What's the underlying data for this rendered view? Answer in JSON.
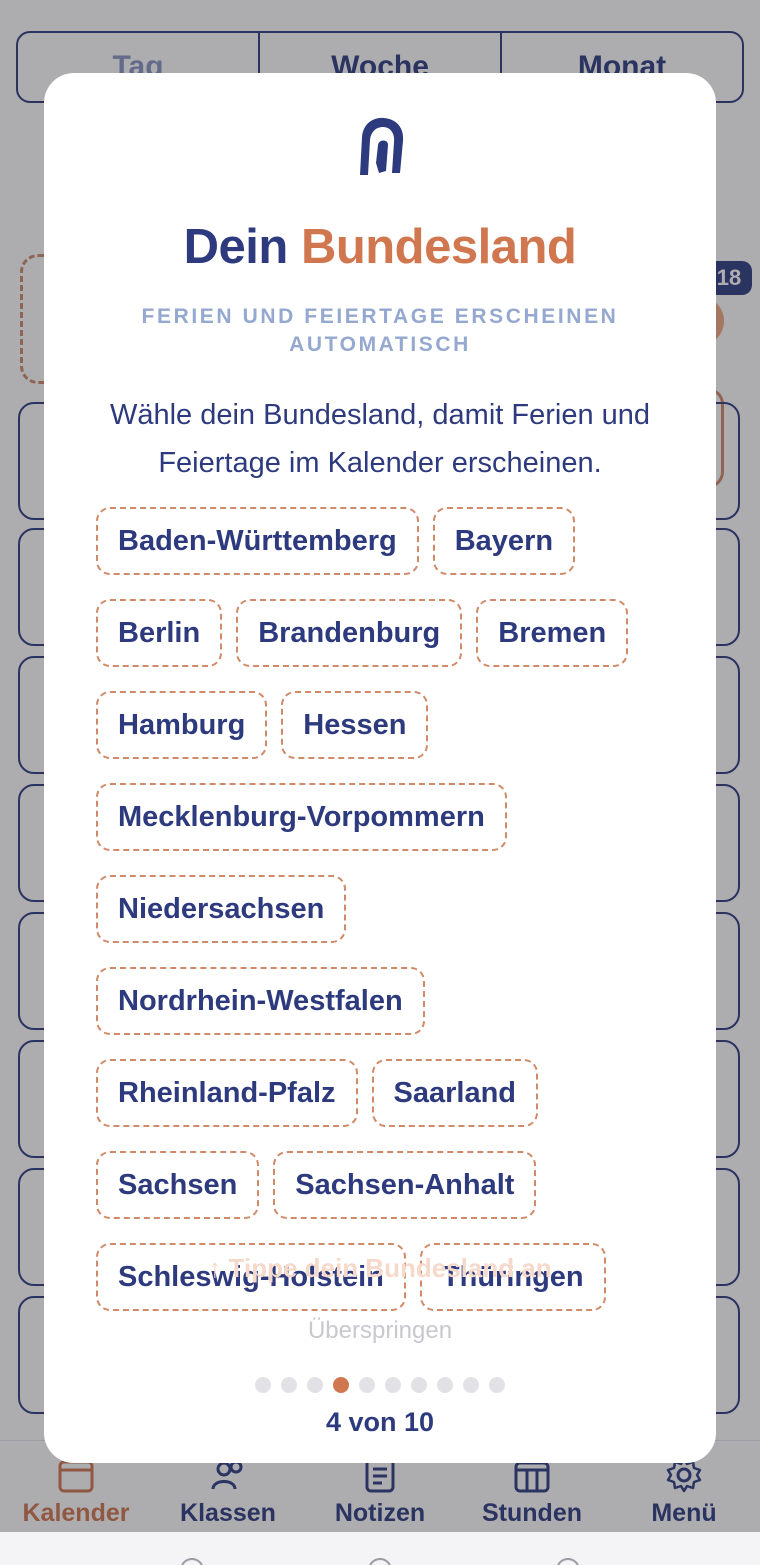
{
  "background": {
    "segments": [
      "Tag",
      "Woche",
      "Monat"
    ],
    "active_segment": 0,
    "badge": "18",
    "nav": [
      {
        "label": "Kalender",
        "icon": "calendar-icon"
      },
      {
        "label": "Klassen",
        "icon": "users-icon"
      },
      {
        "label": "Notizen",
        "icon": "notes-icon"
      },
      {
        "label": "Stunden",
        "icon": "timetable-icon"
      },
      {
        "label": "Menü",
        "icon": "gear-icon"
      }
    ],
    "active_nav": 0
  },
  "modal": {
    "logo_icon": "app-logo-icon",
    "title_part1": "Dein",
    "title_part2": "Bundesland",
    "subtitle": "FERIEN UND FEIERTAGE ERSCHEINEN AUTOMATISCH",
    "description": "Wähle dein Bundesland, damit Ferien und Feiertage im Kalender erscheinen.",
    "states": [
      "Baden-Württemberg",
      "Bayern",
      "Berlin",
      "Brandenburg",
      "Bremen",
      "Hamburg",
      "Hessen",
      "Mecklenburg-Vorpommern",
      "Niedersachsen",
      "Nordrhein-Westfalen",
      "Rheinland-Pfalz",
      "Saarland",
      "Sachsen",
      "Sachsen-Anhalt",
      "Schleswig-Holstein",
      "Thüringen"
    ],
    "hint": "↑ Tippe dein Bundesland an",
    "skip": "Überspringen",
    "step_current": 4,
    "step_total": 10,
    "progress": "4 von 10"
  },
  "colors": {
    "primary": "#2e3a7e",
    "accent": "#d0774f",
    "subtitle": "#95a8cf"
  }
}
